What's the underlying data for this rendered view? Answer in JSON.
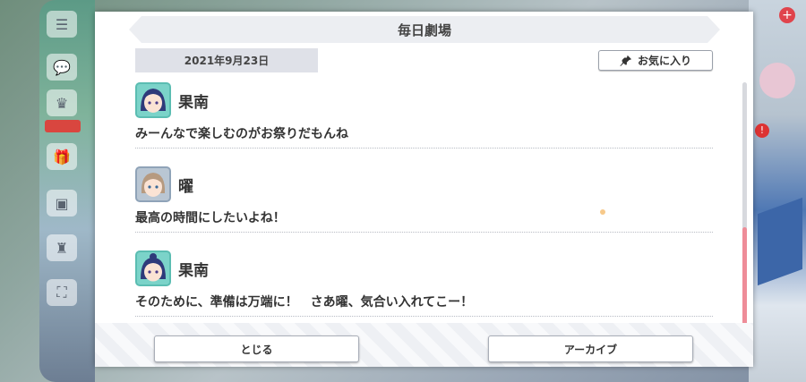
{
  "dialog": {
    "title": "毎日劇場",
    "date": "2021年9月23日",
    "favorite_label": "お気に入り",
    "entries": [
      {
        "speaker": "果南",
        "avatar": "kanan-avatar",
        "line": "みーんなで楽しむのがお祭りだもんね"
      },
      {
        "speaker": "曜",
        "avatar": "you-avatar",
        "line": "最高の時間にしたいよね！"
      },
      {
        "speaker": "果南",
        "avatar": "kanan-avatar",
        "line": "そのために、準備は万端に！　さあ曜、気合い入れてこー！"
      }
    ],
    "close_label": "とじる",
    "archive_label": "アーカイブ"
  },
  "colors": {
    "scroll_thumb": "#ee8c98",
    "title_bar": "#eceef2",
    "date_bg": "#dfe1e8"
  }
}
